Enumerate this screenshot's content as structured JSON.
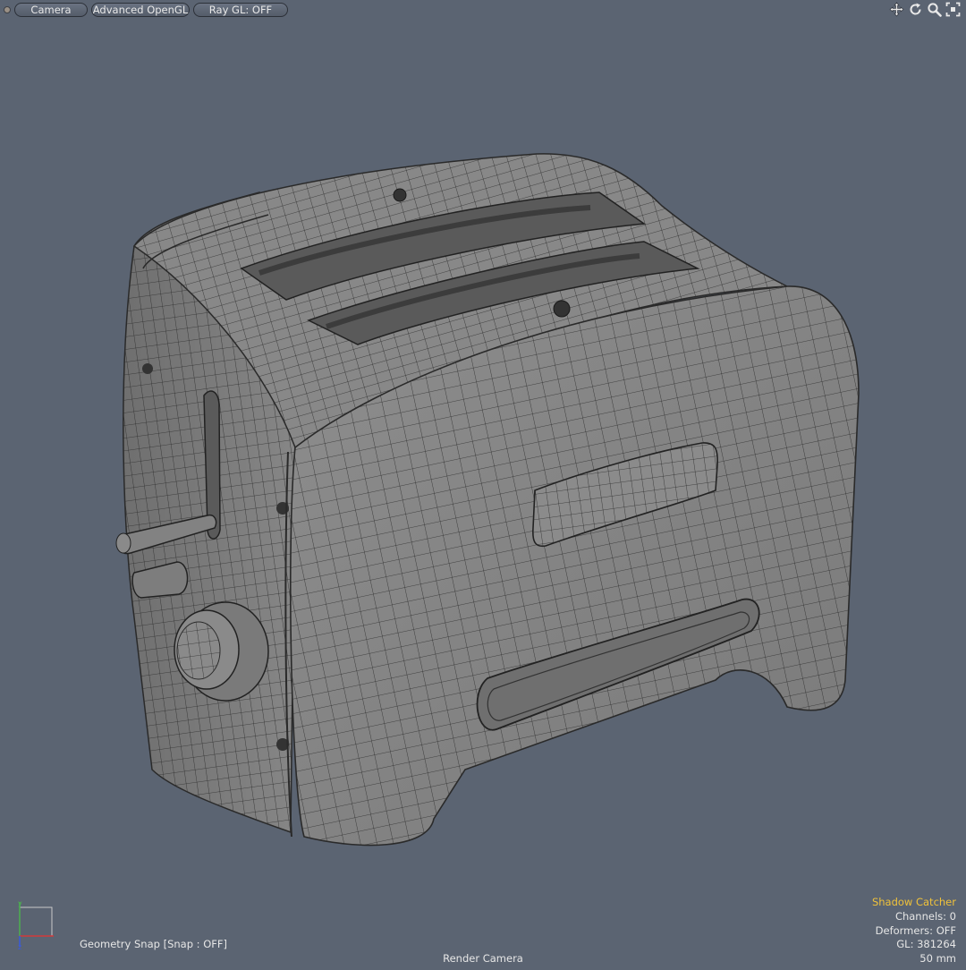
{
  "toolbar": {
    "camera_label": "Camera",
    "opengl_label": "Advanced OpenGL",
    "raygl_label": "Ray GL: OFF",
    "nav_icons": [
      "move-icon",
      "rotate-icon",
      "zoom-icon",
      "fit-icon"
    ]
  },
  "viewport": {
    "background": "#5b6472",
    "model": "toaster wireframe"
  },
  "status": {
    "snap_text": "Geometry Snap  [Snap : OFF]",
    "camera_name": "Render Camera"
  },
  "info": {
    "shadow_catcher": "Shadow Catcher",
    "channels": "Channels: 0",
    "deformers": "Deformers: OFF",
    "gl": "GL: 381264",
    "focal": "50 mm"
  },
  "colors": {
    "accent": "#f0c23a",
    "axis_x": "#d23a3a",
    "axis_y": "#4caf50",
    "axis_z": "#3b5bdb"
  }
}
